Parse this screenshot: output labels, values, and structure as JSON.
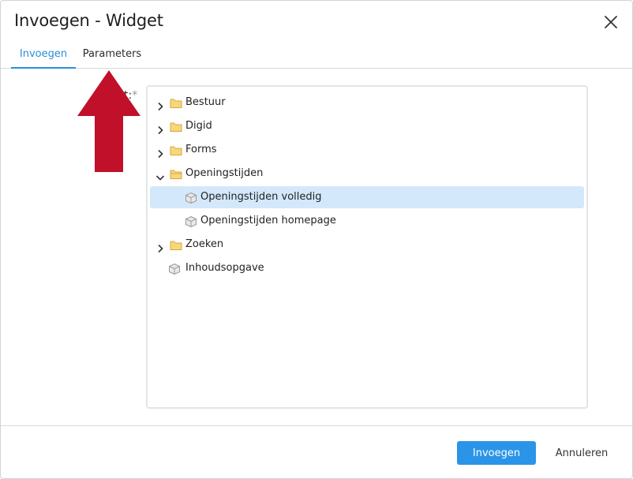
{
  "dialog": {
    "title": "Invoegen - Widget",
    "close_icon": "close-icon"
  },
  "tabs": [
    {
      "label": "Invoegen",
      "active": true
    },
    {
      "label": "Parameters",
      "active": false
    }
  ],
  "field": {
    "label_suffix": "t:",
    "required_mark": "*"
  },
  "tree": {
    "items": [
      {
        "label": "Bestuur",
        "type": "folder",
        "expanded": false
      },
      {
        "label": "Digid",
        "type": "folder",
        "expanded": false
      },
      {
        "label": "Forms",
        "type": "folder",
        "expanded": false
      },
      {
        "label": "Openingstijden",
        "type": "folder",
        "expanded": true
      },
      {
        "label": "Openingstijden volledig",
        "type": "widget",
        "selected": true
      },
      {
        "label": "Openingstijden homepage",
        "type": "widget",
        "selected": false
      },
      {
        "label": "Zoeken",
        "type": "folder",
        "expanded": false
      },
      {
        "label": "Inhoudsopgave",
        "type": "widget",
        "selected": false
      }
    ]
  },
  "buttons": {
    "primary": "Invoegen",
    "secondary": "Annuleren"
  },
  "colors": {
    "accent": "#2a95e8",
    "selection": "#d3e8fb",
    "annotation_arrow": "#c0102a",
    "folder": "#f5d27a"
  },
  "icons": {
    "folder": "folder-icon",
    "widget": "widget-box-icon",
    "chevron_right": "chevron-right-icon",
    "chevron_down": "chevron-down-icon",
    "annotation": "red-arrow-up-icon"
  }
}
